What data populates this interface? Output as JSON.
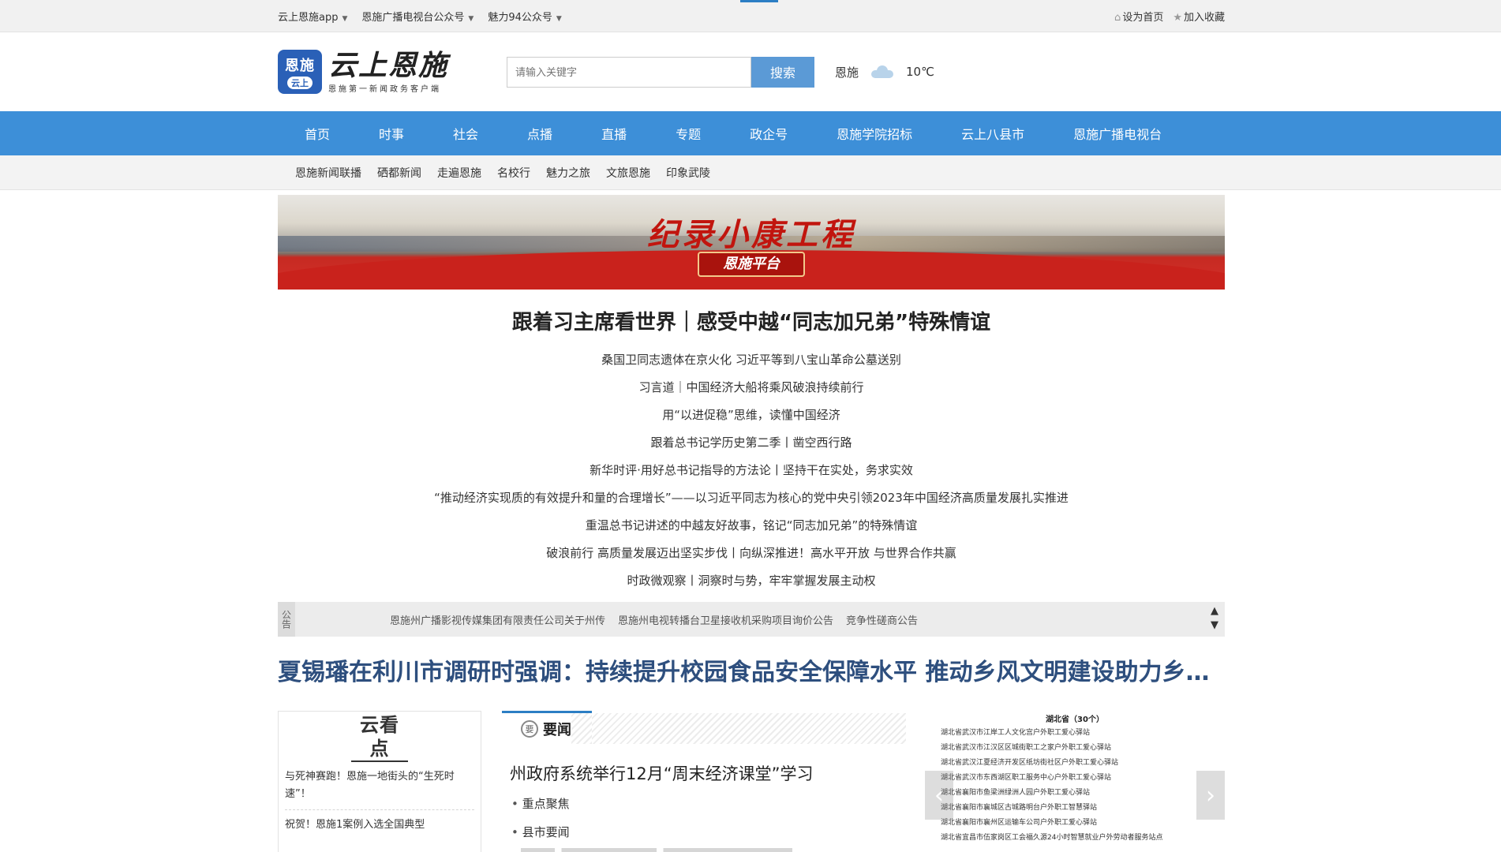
{
  "topbar": {
    "links": [
      "云上恩施app",
      "恩施广播电视台公众号",
      "魅力94公众号"
    ],
    "set_home": "设为首页",
    "add_fav": "加入收藏"
  },
  "header": {
    "logo_badge_top": "恩施",
    "logo_badge_bottom": "云上",
    "logo_title": "云上恩施",
    "logo_slogan": "恩施第一新闻政务客户端",
    "search_placeholder": "请输入关键字",
    "search_button": "搜索",
    "weather_city": "恩施",
    "weather_icon": "cloud-icon",
    "weather_temp": "10℃"
  },
  "main_nav": [
    "首页",
    "时事",
    "社会",
    "点播",
    "直播",
    "专题",
    "政企号",
    "恩施学院招标",
    "云上八县市",
    "恩施广播电视台"
  ],
  "sub_nav": [
    "恩施新闻联播",
    "硒都新闻",
    "走遍恩施",
    "名校行",
    "魅力之旅",
    "文旅恩施",
    "印象武陵"
  ],
  "banner": {
    "title": "纪录小康工程",
    "badge": "恩施平台"
  },
  "headline": {
    "title": "跟着习主席看世界｜感受中越“同志加兄弟”特殊情谊",
    "items": [
      "桑国卫同志遗体在京火化 习近平等到八宝山革命公墓送别",
      "习言道｜中国经济大船将乘风破浪持续前行",
      "用“以进促稳”思维，读懂中国经济",
      "跟着总书记学历史第二季丨凿空西行路",
      "新华时评·用好总书记指导的方法论丨坚持干在实处，务求实效",
      "“推动经济实现质的有效提升和量的合理增长”——以习近平同志为核心的党中央引领2023年中国经济高质量发展扎实推进",
      "重温总书记讲述的中越友好故事，铭记“同志加兄弟”的特殊情谊",
      "破浪前行 高质量发展迈出坚实步伐丨向纵深推进！高水平开放 与世界合作共赢",
      "时政微观察丨洞察时与势，牢牢掌握发展主动权"
    ]
  },
  "notice": {
    "tag": "公告",
    "items": [
      "恩施州广播影视传媒集团有限责任公司关于州传",
      "恩施州电视转播台卫星接收机采购项目询价公告",
      "竞争性磋商公告"
    ]
  },
  "big_headline": "夏锡璠在利川市调研时强调：持续提升校园食品安全保障水平 推动乡风文明建设助力乡村振兴",
  "yunkan": {
    "logo": "云看点",
    "items": [
      "与死神赛跑！恩施一地街头的“生死时速”！",
      "祝贺！恩施1案例入选全国典型"
    ]
  },
  "news": {
    "tab_icon": "要",
    "tab_label": "要闻",
    "title": "州政府系统举行12月“周末经济课堂”学习",
    "links": [
      "重点聚焦",
      "县市要闻"
    ]
  },
  "province_list": {
    "title": "湖北省（30个）",
    "items": [
      "湖北省武汉市江岸工人文化宫户外职工爱心驿站",
      "湖北省武汉市江汉区区城街职工之家户外职工爱心驿站",
      "湖北省武汉江夏经济开发区纸坊街社区户外职工爱心驿站",
      "湖北省武汉市东西湖区职工服务中心户外职工爱心驿站",
      "湖北省襄阳市鱼梁洲绿洲人园户外职工爱心驿站",
      "湖北省襄阳市襄城区古城路明台户外职工智慧驿站",
      "湖北省襄阳市襄州区运输车公司户外职工爱心驿站",
      "湖北省宜昌市伍家岗区工会福久源24小时智慧就业户外劳动者服务站点"
    ]
  }
}
